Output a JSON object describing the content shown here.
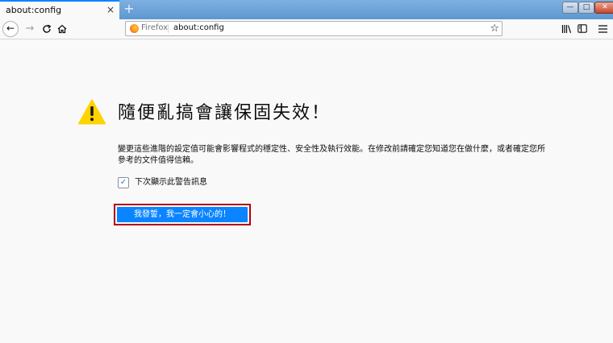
{
  "tab": {
    "title": "about:config",
    "close_glyph": "×",
    "new_tab_glyph": "+"
  },
  "window_controls": {
    "minimize": "—",
    "maximize": "□",
    "close": "✕"
  },
  "toolbar": {
    "identity_label": "Firefox",
    "url": "about:config",
    "icons": [
      "back-icon",
      "forward-icon",
      "reload-icon",
      "home-icon",
      "bookmark-star-icon",
      "library-icon",
      "sidebar-icon",
      "menu-icon"
    ]
  },
  "warning": {
    "title": "隨便亂搞會讓保固失效！",
    "description": "變更這些進階的設定值可能會影響程式的穩定性、安全性及執行效能。在修改前請確定您知道您在做什麼，或者確定您所參考的文件值得信賴。",
    "checkbox_label": "下次顯示此警告訊息",
    "checkbox_checked": true,
    "accept_button": "我發誓，我一定會小心的！"
  },
  "colors": {
    "accent": "#0a84ff",
    "warning_icon": "#ffd300",
    "highlight_outline": "#b30010"
  }
}
